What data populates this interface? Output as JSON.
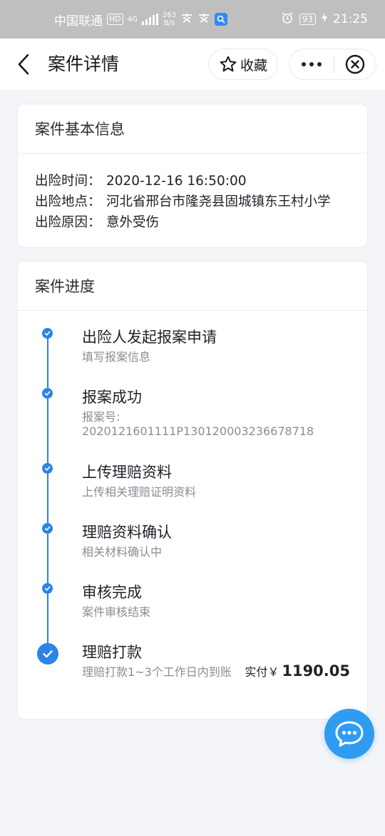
{
  "status_bar": {
    "carrier": "中国联通",
    "hd": "HD",
    "network": "4G",
    "speed_value": "263",
    "speed_unit": "B/s",
    "battery": "93",
    "time": "21:25"
  },
  "nav": {
    "title": "案件详情",
    "favorite_label": "收藏"
  },
  "basic_info": {
    "heading": "案件基本信息",
    "rows": [
      {
        "label": "出险时间：",
        "value": "2020-12-16 16:50:00"
      },
      {
        "label": "出险地点：",
        "value": "河北省邢台市隆尧县固城镇东王村小学"
      },
      {
        "label": "出险原因：",
        "value": "意外受伤"
      }
    ]
  },
  "progress": {
    "heading": "案件进度",
    "steps": [
      {
        "title": "出险人发起报案申请",
        "desc": "填写报案信息"
      },
      {
        "title": "报案成功",
        "desc": "报案号:",
        "desc2": "2020121601111P130120003236678718"
      },
      {
        "title": "上传理赔资料",
        "desc": "上传相关理赔证明资料"
      },
      {
        "title": "理赔资料确认",
        "desc": "相关材料确认中"
      },
      {
        "title": "审核完成",
        "desc": "案件审核结束"
      },
      {
        "title": "理赔打款",
        "desc": "理赔打款1~3个工作日内到账"
      }
    ],
    "paid_label": "实付￥",
    "paid_amount": "1190.05"
  },
  "colors": {
    "accent": "#2b84e6",
    "fab": "#2f9cf2"
  },
  "icons": {
    "back": "chevron-left-icon",
    "favorite": "star-outline-icon",
    "more": "more-dots-icon",
    "close": "circle-close-icon",
    "check": "check-icon",
    "chat": "chat-bubble-icon"
  }
}
